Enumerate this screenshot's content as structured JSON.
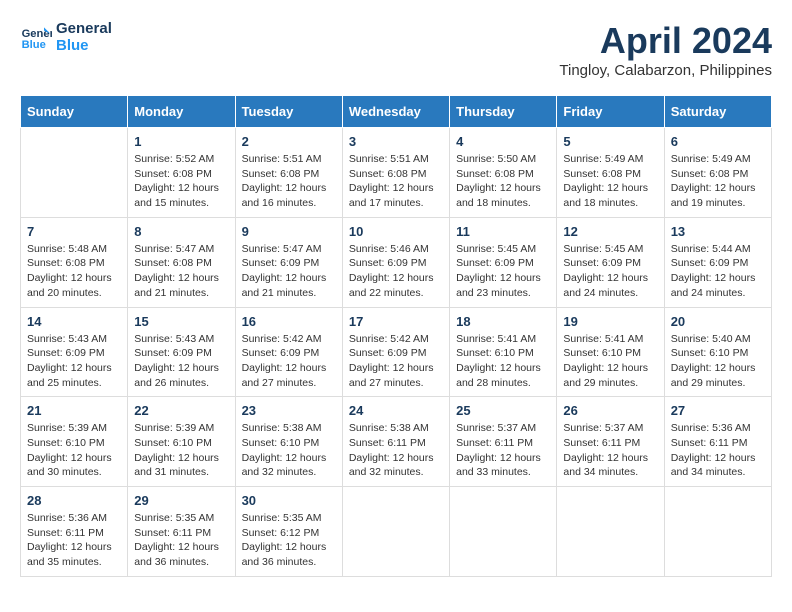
{
  "logo": {
    "line1": "General",
    "line2": "Blue"
  },
  "title": "April 2024",
  "location": "Tingloy, Calabarzon, Philippines",
  "days_header": [
    "Sunday",
    "Monday",
    "Tuesday",
    "Wednesday",
    "Thursday",
    "Friday",
    "Saturday"
  ],
  "weeks": [
    [
      {
        "day": "",
        "info": ""
      },
      {
        "day": "1",
        "info": "Sunrise: 5:52 AM\nSunset: 6:08 PM\nDaylight: 12 hours\nand 15 minutes."
      },
      {
        "day": "2",
        "info": "Sunrise: 5:51 AM\nSunset: 6:08 PM\nDaylight: 12 hours\nand 16 minutes."
      },
      {
        "day": "3",
        "info": "Sunrise: 5:51 AM\nSunset: 6:08 PM\nDaylight: 12 hours\nand 17 minutes."
      },
      {
        "day": "4",
        "info": "Sunrise: 5:50 AM\nSunset: 6:08 PM\nDaylight: 12 hours\nand 18 minutes."
      },
      {
        "day": "5",
        "info": "Sunrise: 5:49 AM\nSunset: 6:08 PM\nDaylight: 12 hours\nand 18 minutes."
      },
      {
        "day": "6",
        "info": "Sunrise: 5:49 AM\nSunset: 6:08 PM\nDaylight: 12 hours\nand 19 minutes."
      }
    ],
    [
      {
        "day": "7",
        "info": "Sunrise: 5:48 AM\nSunset: 6:08 PM\nDaylight: 12 hours\nand 20 minutes."
      },
      {
        "day": "8",
        "info": "Sunrise: 5:47 AM\nSunset: 6:08 PM\nDaylight: 12 hours\nand 21 minutes."
      },
      {
        "day": "9",
        "info": "Sunrise: 5:47 AM\nSunset: 6:09 PM\nDaylight: 12 hours\nand 21 minutes."
      },
      {
        "day": "10",
        "info": "Sunrise: 5:46 AM\nSunset: 6:09 PM\nDaylight: 12 hours\nand 22 minutes."
      },
      {
        "day": "11",
        "info": "Sunrise: 5:45 AM\nSunset: 6:09 PM\nDaylight: 12 hours\nand 23 minutes."
      },
      {
        "day": "12",
        "info": "Sunrise: 5:45 AM\nSunset: 6:09 PM\nDaylight: 12 hours\nand 24 minutes."
      },
      {
        "day": "13",
        "info": "Sunrise: 5:44 AM\nSunset: 6:09 PM\nDaylight: 12 hours\nand 24 minutes."
      }
    ],
    [
      {
        "day": "14",
        "info": "Sunrise: 5:43 AM\nSunset: 6:09 PM\nDaylight: 12 hours\nand 25 minutes."
      },
      {
        "day": "15",
        "info": "Sunrise: 5:43 AM\nSunset: 6:09 PM\nDaylight: 12 hours\nand 26 minutes."
      },
      {
        "day": "16",
        "info": "Sunrise: 5:42 AM\nSunset: 6:09 PM\nDaylight: 12 hours\nand 27 minutes."
      },
      {
        "day": "17",
        "info": "Sunrise: 5:42 AM\nSunset: 6:09 PM\nDaylight: 12 hours\nand 27 minutes."
      },
      {
        "day": "18",
        "info": "Sunrise: 5:41 AM\nSunset: 6:10 PM\nDaylight: 12 hours\nand 28 minutes."
      },
      {
        "day": "19",
        "info": "Sunrise: 5:41 AM\nSunset: 6:10 PM\nDaylight: 12 hours\nand 29 minutes."
      },
      {
        "day": "20",
        "info": "Sunrise: 5:40 AM\nSunset: 6:10 PM\nDaylight: 12 hours\nand 29 minutes."
      }
    ],
    [
      {
        "day": "21",
        "info": "Sunrise: 5:39 AM\nSunset: 6:10 PM\nDaylight: 12 hours\nand 30 minutes."
      },
      {
        "day": "22",
        "info": "Sunrise: 5:39 AM\nSunset: 6:10 PM\nDaylight: 12 hours\nand 31 minutes."
      },
      {
        "day": "23",
        "info": "Sunrise: 5:38 AM\nSunset: 6:10 PM\nDaylight: 12 hours\nand 32 minutes."
      },
      {
        "day": "24",
        "info": "Sunrise: 5:38 AM\nSunset: 6:11 PM\nDaylight: 12 hours\nand 32 minutes."
      },
      {
        "day": "25",
        "info": "Sunrise: 5:37 AM\nSunset: 6:11 PM\nDaylight: 12 hours\nand 33 minutes."
      },
      {
        "day": "26",
        "info": "Sunrise: 5:37 AM\nSunset: 6:11 PM\nDaylight: 12 hours\nand 34 minutes."
      },
      {
        "day": "27",
        "info": "Sunrise: 5:36 AM\nSunset: 6:11 PM\nDaylight: 12 hours\nand 34 minutes."
      }
    ],
    [
      {
        "day": "28",
        "info": "Sunrise: 5:36 AM\nSunset: 6:11 PM\nDaylight: 12 hours\nand 35 minutes."
      },
      {
        "day": "29",
        "info": "Sunrise: 5:35 AM\nSunset: 6:11 PM\nDaylight: 12 hours\nand 36 minutes."
      },
      {
        "day": "30",
        "info": "Sunrise: 5:35 AM\nSunset: 6:12 PM\nDaylight: 12 hours\nand 36 minutes."
      },
      {
        "day": "",
        "info": ""
      },
      {
        "day": "",
        "info": ""
      },
      {
        "day": "",
        "info": ""
      },
      {
        "day": "",
        "info": ""
      }
    ]
  ]
}
